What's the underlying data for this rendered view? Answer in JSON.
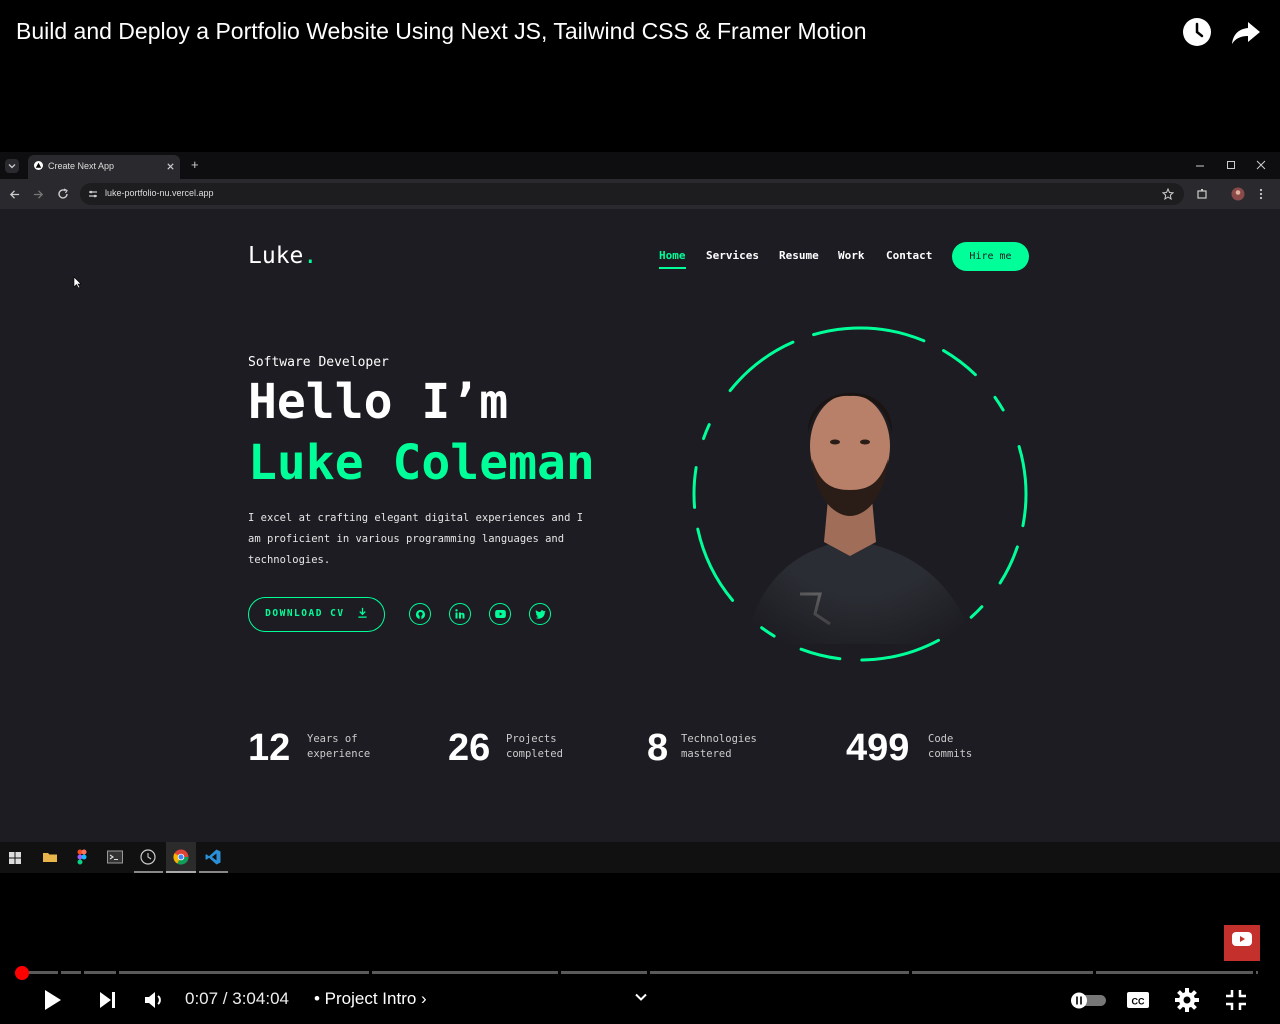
{
  "video": {
    "title": "Build and Deploy a Portfolio Website Using Next JS, Tailwind CSS & Framer Motion",
    "icons": [
      "watch-later-icon",
      "share-icon"
    ]
  },
  "browser": {
    "tab_title": "Create Next App",
    "new_tab": "+",
    "url": "luke-portfolio-nu.vercel.app"
  },
  "site": {
    "logo_text": "Luke",
    "logo_dot": ".",
    "nav": [
      "Home",
      "Services",
      "Resume",
      "Work",
      "Contact"
    ],
    "active_nav": "Home",
    "hire_label": "Hire me",
    "role": "Software Developer",
    "greeting": "Hello I’m",
    "name": "Luke Coleman",
    "description": "I excel at crafting elegant digital experiences and I am proficient in various programming languages and technologies.",
    "download_label": "DOWNLOAD CV",
    "socials": [
      "github-icon",
      "linkedin-icon",
      "youtube-icon",
      "twitter-icon"
    ],
    "stats": [
      {
        "value": "12",
        "label1": "Years of",
        "label2": "experience"
      },
      {
        "value": "26",
        "label1": "Projects",
        "label2": "completed"
      },
      {
        "value": "8",
        "label1": "Technologies",
        "label2": "mastered"
      },
      {
        "value": "499",
        "label1": "Code",
        "label2": "commits"
      }
    ],
    "accent": "#00ff99",
    "background": "#1c1c22"
  },
  "taskbar": {
    "apps": [
      "windows-start-icon",
      "file-explorer-icon",
      "figma-icon",
      "terminal-icon",
      "clock-app-icon",
      "chrome-icon",
      "vscode-icon"
    ]
  },
  "player": {
    "current_time": "0:07",
    "duration": "3:04:04",
    "time_display": "0:07 / 3:04:04",
    "chapter": "• Project Intro ›",
    "played_fraction": 0.0006,
    "progress_color": "#ff0000"
  }
}
